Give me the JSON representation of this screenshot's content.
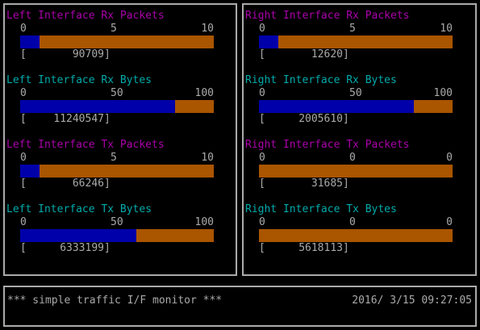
{
  "colors": {
    "packets_title": "#aa00aa",
    "bytes_title": "#00aaaa",
    "text": "#aaaaaa",
    "bar_fill": "#0000aa",
    "bar_bg": "#aa5500",
    "border": "#aaaaaa"
  },
  "panels": [
    {
      "name": "left",
      "gauges": [
        {
          "title": "Left Interface Rx Packets",
          "kind": "packets",
          "scale": [
            "0",
            "5",
            "10"
          ],
          "fill": 0.1,
          "value": "90709"
        },
        {
          "title": "Left Interface Rx Bytes",
          "kind": "bytes",
          "scale": [
            "0",
            "50",
            "100"
          ],
          "fill": 0.8,
          "value": "11240547"
        },
        {
          "title": "Left Interface Tx Packets",
          "kind": "packets",
          "scale": [
            "0",
            "5",
            "10"
          ],
          "fill": 0.1,
          "value": "66246"
        },
        {
          "title": "Left Interface Tx Bytes",
          "kind": "bytes",
          "scale": [
            "0",
            "50",
            "100"
          ],
          "fill": 0.6,
          "value": "6333199"
        }
      ]
    },
    {
      "name": "right",
      "gauges": [
        {
          "title": "Right Interface Rx Packets",
          "kind": "packets",
          "scale": [
            "0",
            "5",
            "10"
          ],
          "fill": 0.1,
          "value": "12620"
        },
        {
          "title": "Right Interface Rx Bytes",
          "kind": "bytes",
          "scale": [
            "0",
            "50",
            "100"
          ],
          "fill": 0.8,
          "value": "2005610"
        },
        {
          "title": "Right Interface Tx Packets",
          "kind": "packets",
          "scale": [
            "0",
            "0",
            "0"
          ],
          "fill": 0,
          "value": "31685"
        },
        {
          "title": "Right Interface Tx Bytes",
          "kind": "bytes",
          "scale": [
            "0",
            "0",
            "0"
          ],
          "fill": 0,
          "value": "5618113"
        }
      ]
    }
  ],
  "status": {
    "title": "*** simple traffic I/F monitor ***",
    "datetime": "2016/ 3/15 09:27:05"
  }
}
